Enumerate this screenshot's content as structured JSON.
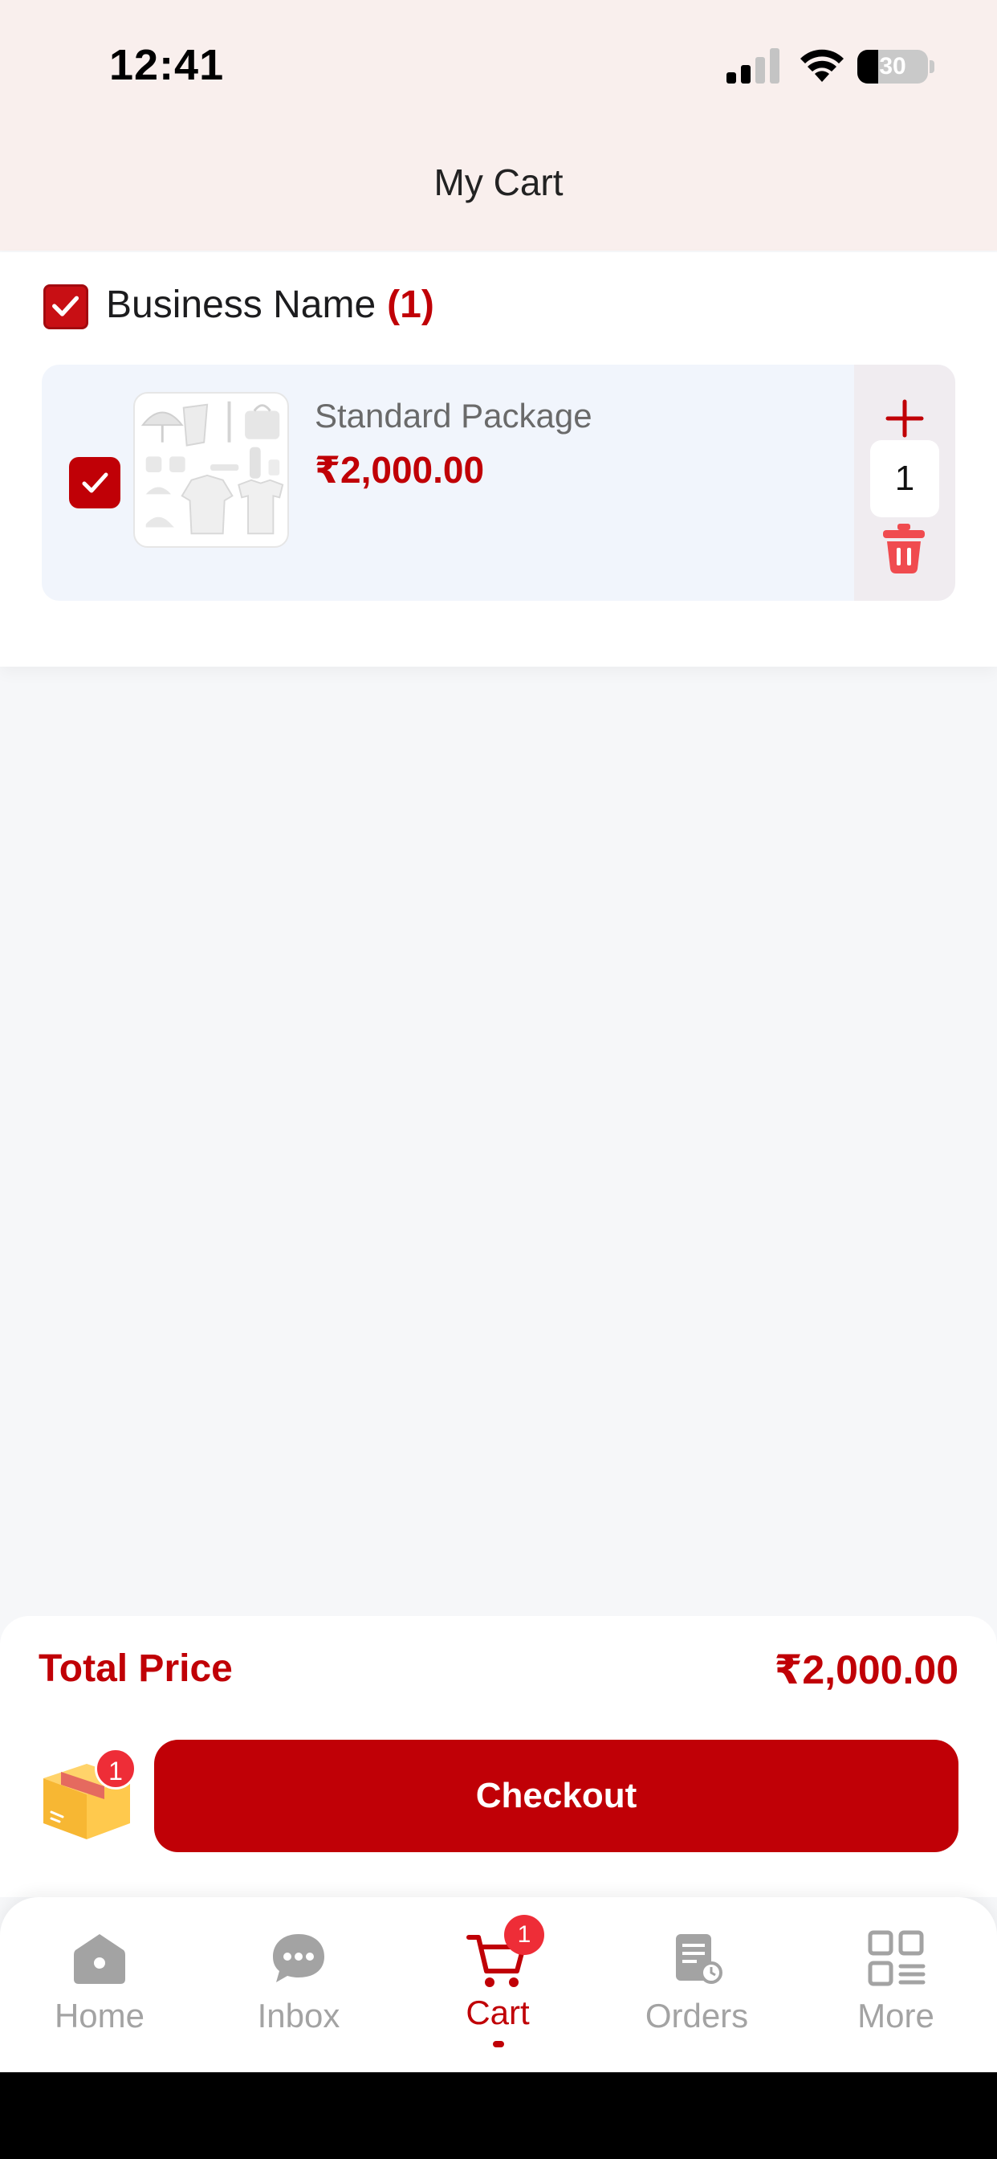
{
  "status_bar": {
    "time": "12:41",
    "battery_percent": "30",
    "battery_level": 0.3
  },
  "header": {
    "title": "My Cart"
  },
  "shop": {
    "name": "Business Name",
    "count": "(1)",
    "selected": true,
    "items": [
      {
        "name": "Standard Package",
        "price": "₹2,000.00",
        "quantity": "1",
        "selected": true,
        "image_icon": "merchandise-collection-image"
      }
    ]
  },
  "summary": {
    "total_label": "Total Price",
    "total_value": "₹2,000.00",
    "box_badge": "1",
    "checkout_label": "Checkout"
  },
  "tabs": [
    {
      "label": "Home",
      "icon": "home-icon",
      "active": false
    },
    {
      "label": "Inbox",
      "icon": "chat-icon",
      "active": false
    },
    {
      "label": "Cart",
      "icon": "cart-icon",
      "active": true,
      "badge": "1"
    },
    {
      "label": "Orders",
      "icon": "orders-icon",
      "active": false
    },
    {
      "label": "More",
      "icon": "grid-icon",
      "active": false
    }
  ],
  "colors": {
    "accent": "#c00006",
    "badge": "#ee2d37",
    "header_bg": "#f9efed",
    "inactive_tab": "#a3a3a3"
  }
}
